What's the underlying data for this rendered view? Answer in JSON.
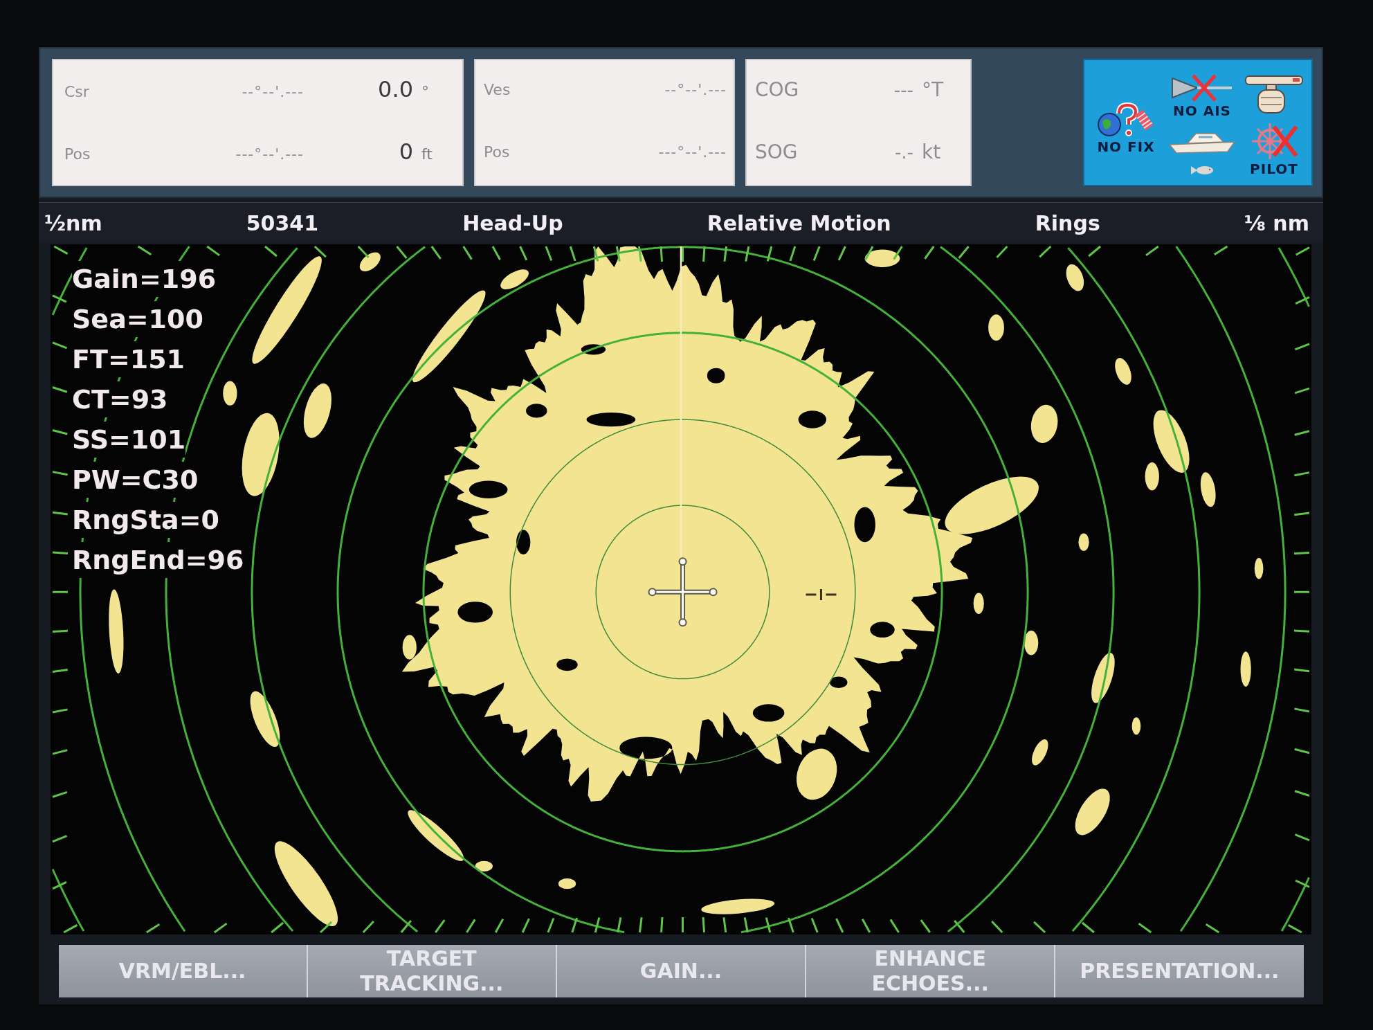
{
  "data_panels": [
    {
      "rows": [
        {
          "label": "Csr",
          "position": "--°--'.---",
          "value": "0.0",
          "unit": "°"
        },
        {
          "label": "Pos",
          "position": "---°--'.---",
          "value": "0",
          "unit": "ft"
        }
      ]
    },
    {
      "rows": [
        {
          "label": "Ves",
          "position": "--°--'.---"
        },
        {
          "label": "Pos",
          "position": "---°--'.---"
        }
      ]
    },
    {
      "rows": [
        {
          "label": "COG",
          "value": "---",
          "unit": "°T"
        },
        {
          "label": "SOG",
          "value": "-.-",
          "unit": "kt"
        }
      ]
    }
  ],
  "status": [
    {
      "kind": "gps",
      "label": "NO FIX",
      "crossed": false
    },
    {
      "kind": "ais",
      "label": "NO AIS",
      "crossed": true
    },
    {
      "kind": "radar",
      "crossed": false
    },
    {
      "kind": "boat",
      "crossed": false
    },
    {
      "kind": "fish",
      "crossed": false
    },
    {
      "kind": "pilot",
      "label": "PILOT",
      "crossed": true
    }
  ],
  "header": [
    "½nm",
    "50341",
    "Head-Up",
    "Relative Motion",
    "Rings",
    "⅛ nm"
  ],
  "radar_settings": [
    "Gain=196",
    "Sea=100",
    "FT=151",
    "CT=93",
    "SS=101",
    "PW=C30",
    "RngSta=0",
    "RngEnd=96"
  ],
  "soft_keys": [
    "VRM/EBL...",
    "TARGET\nTRACKING...",
    "GAIN...",
    "ENHANCE\nECHOES...",
    "PRESENTATION..."
  ]
}
